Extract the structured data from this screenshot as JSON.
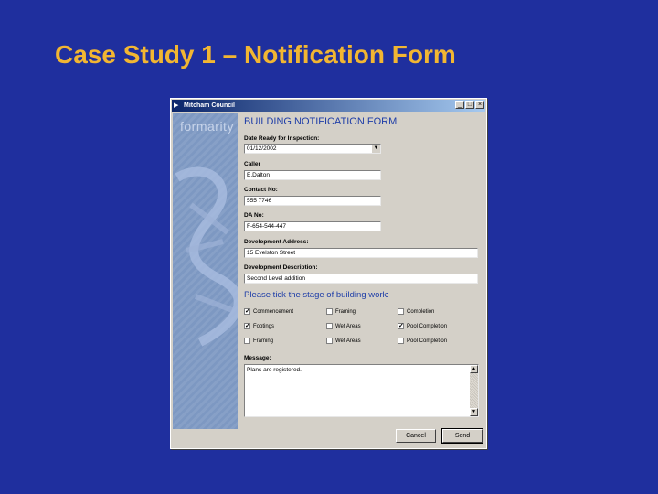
{
  "slide": {
    "title": "Case Study 1 – Notification Form"
  },
  "window": {
    "title": "Mitcham Council",
    "controls": {
      "minimize": "_",
      "maximize": "□",
      "close": "×"
    }
  },
  "sidebar": {
    "logo": "formarity"
  },
  "form": {
    "heading": "BUILDING NOTIFICATION FORM",
    "date_ready": {
      "label": "Date Ready for Inspection:",
      "value": "01/12/2002"
    },
    "caller": {
      "label": "Caller",
      "value": "E.Dalton"
    },
    "contact": {
      "label": "Contact No:",
      "value": "555 7746"
    },
    "da_no": {
      "label": "DA No:",
      "value": "F-654-544-447"
    },
    "dev_address": {
      "label": "Development Address:",
      "value": "15 Evelston Street"
    },
    "dev_description": {
      "label": "Development Description:",
      "value": "Second Level addition"
    },
    "stage_heading": "Please tick the stage of building work:",
    "stages": [
      {
        "label": "Commencement",
        "checked": true
      },
      {
        "label": "Framing",
        "checked": false
      },
      {
        "label": "Completion",
        "checked": false
      },
      {
        "label": "Footings",
        "checked": true
      },
      {
        "label": "Wet Areas",
        "checked": false
      },
      {
        "label": "Pool Completion",
        "checked": true
      },
      {
        "label": "Framing",
        "checked": false
      },
      {
        "label": "Wet Areas",
        "checked": false
      },
      {
        "label": "Pool Completion",
        "checked": false
      }
    ],
    "message": {
      "label": "Message:",
      "value": "Plans are registered."
    }
  },
  "buttons": {
    "cancel": "Cancel",
    "send": "Send"
  }
}
